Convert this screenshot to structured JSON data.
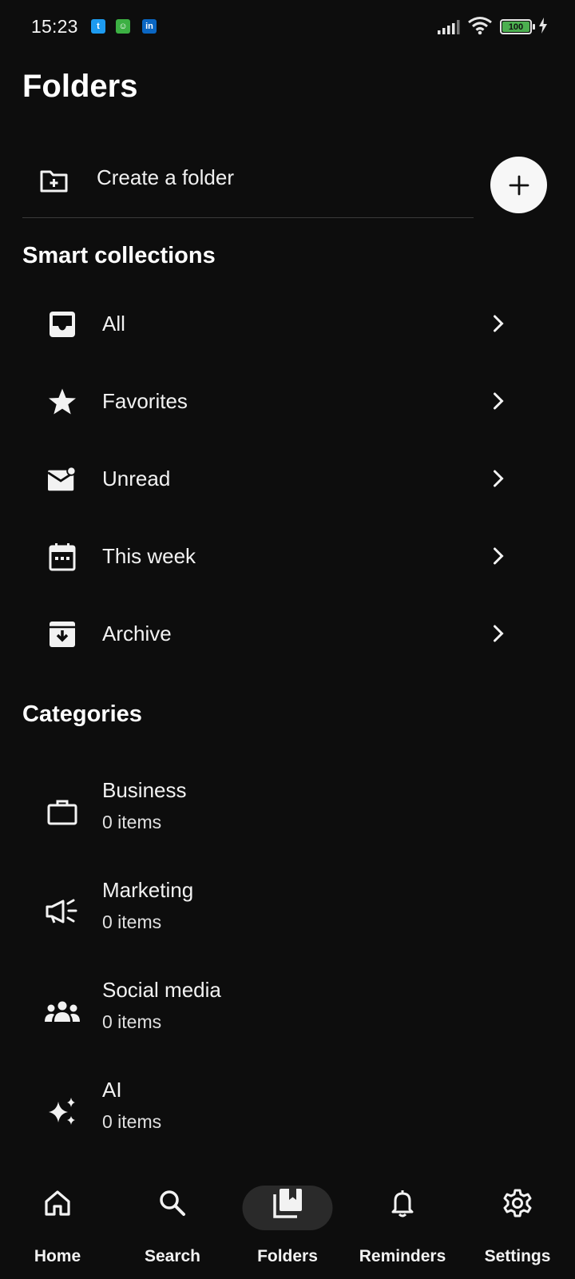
{
  "status_bar": {
    "time": "15:23",
    "battery": "100",
    "notifications": [
      {
        "icon": "twitter-icon",
        "glyph": "t",
        "color": "#1d9bf0"
      },
      {
        "icon": "chat-icon",
        "glyph": "☺",
        "color": "#3cb043"
      },
      {
        "icon": "linkedin-icon",
        "glyph": "in",
        "color": "#0a66c2"
      }
    ]
  },
  "page": {
    "title": "Folders"
  },
  "create_folder": {
    "label": "Create a folder"
  },
  "smart_collections": {
    "title": "Smart collections",
    "items": [
      {
        "label": "All",
        "icon": "inbox-icon"
      },
      {
        "label": "Favorites",
        "icon": "star-icon"
      },
      {
        "label": "Unread",
        "icon": "mail-unread-icon"
      },
      {
        "label": "This week",
        "icon": "calendar-icon"
      },
      {
        "label": "Archive",
        "icon": "archive-icon"
      }
    ]
  },
  "categories": {
    "title": "Categories",
    "items": [
      {
        "name": "Business",
        "count": "0 items",
        "icon": "briefcase-icon"
      },
      {
        "name": "Marketing",
        "count": "0 items",
        "icon": "megaphone-icon"
      },
      {
        "name": "Social media",
        "count": "0 items",
        "icon": "group-icon"
      },
      {
        "name": "AI",
        "count": "0 items",
        "icon": "sparkles-icon"
      }
    ]
  },
  "bottom_nav": {
    "items": [
      {
        "label": "Home",
        "icon": "home-icon"
      },
      {
        "label": "Search",
        "icon": "search-icon"
      },
      {
        "label": "Folders",
        "icon": "folders-icon",
        "active": true
      },
      {
        "label": "Reminders",
        "icon": "bell-icon"
      },
      {
        "label": "Settings",
        "icon": "gear-icon"
      }
    ]
  },
  "colors": {
    "background": "#0d0d0d",
    "text": "#f2f2f2",
    "fab": "#f7f7f7",
    "active_pill": "#2a2a2a",
    "battery": "#4caf50"
  }
}
